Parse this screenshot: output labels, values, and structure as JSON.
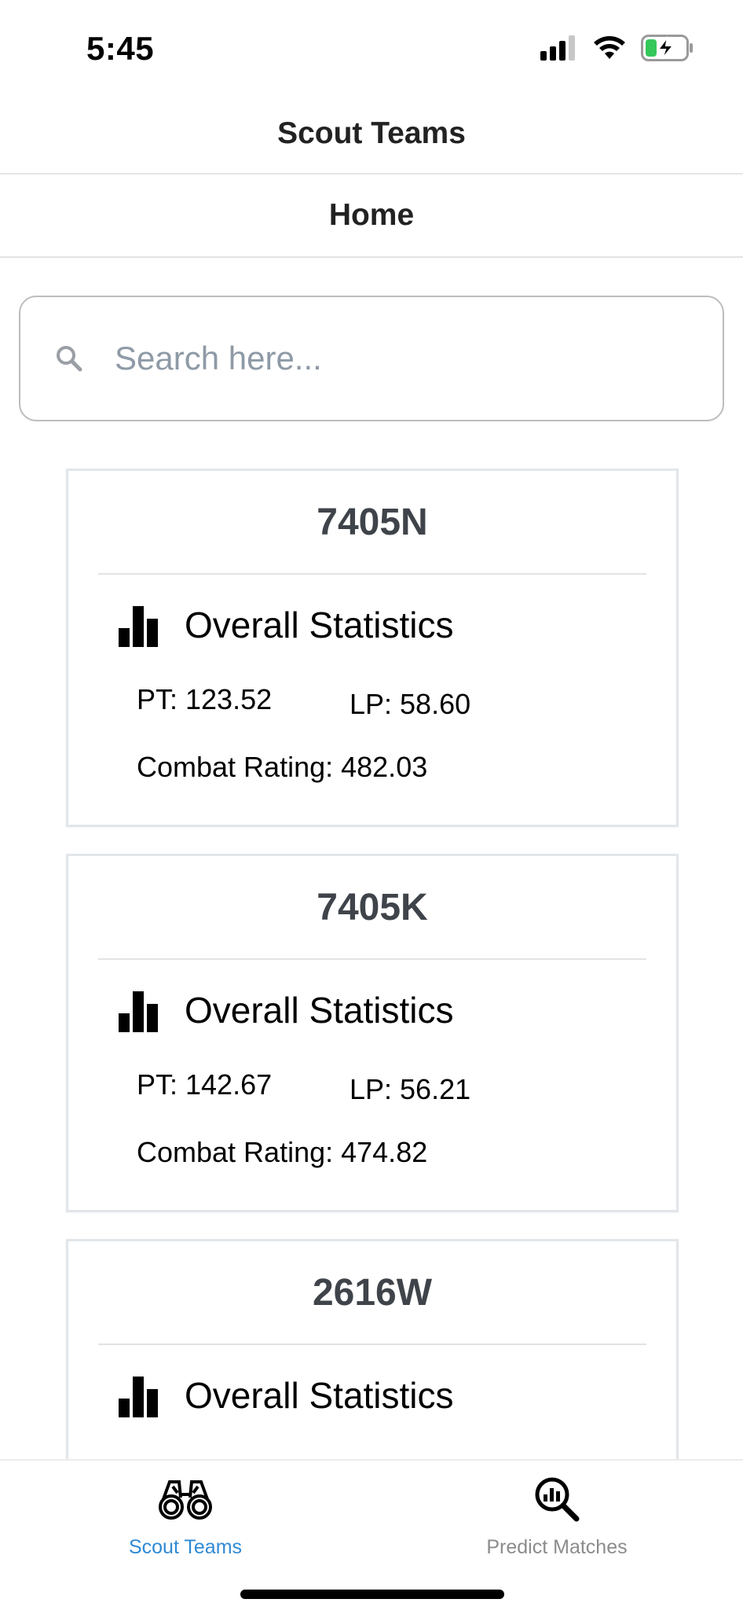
{
  "status_bar": {
    "time": "5:45",
    "icons": [
      "cellular-signal-icon",
      "wifi-icon",
      "battery-charging-icon"
    ],
    "battery_color": "#34c759"
  },
  "header": {
    "title": "Scout Teams"
  },
  "sub_header": {
    "title": "Home"
  },
  "search": {
    "placeholder": "Search here...",
    "value": "",
    "icon": "search-icon"
  },
  "teams": [
    {
      "name": "7405N",
      "section_title": "Overall Statistics",
      "pt": "PT: 123.52",
      "lp": "LP: 58.60",
      "combat_rating": "Combat Rating: 482.03"
    },
    {
      "name": "7405K",
      "section_title": "Overall Statistics",
      "pt": "PT: 142.67",
      "lp": "LP: 56.21",
      "combat_rating": "Combat Rating: 474.82"
    },
    {
      "name": "2616W",
      "section_title": "Overall Statistics",
      "pt": "",
      "lp": "",
      "combat_rating": ""
    }
  ],
  "tab_bar": {
    "tabs": [
      {
        "label": "Scout Teams",
        "icon": "binoculars-icon",
        "active": true
      },
      {
        "label": "Predict Matches",
        "icon": "chart-magnifier-icon",
        "active": false
      }
    ],
    "active_color": "#2f8ad4",
    "inactive_color": "#8c8c8c"
  }
}
